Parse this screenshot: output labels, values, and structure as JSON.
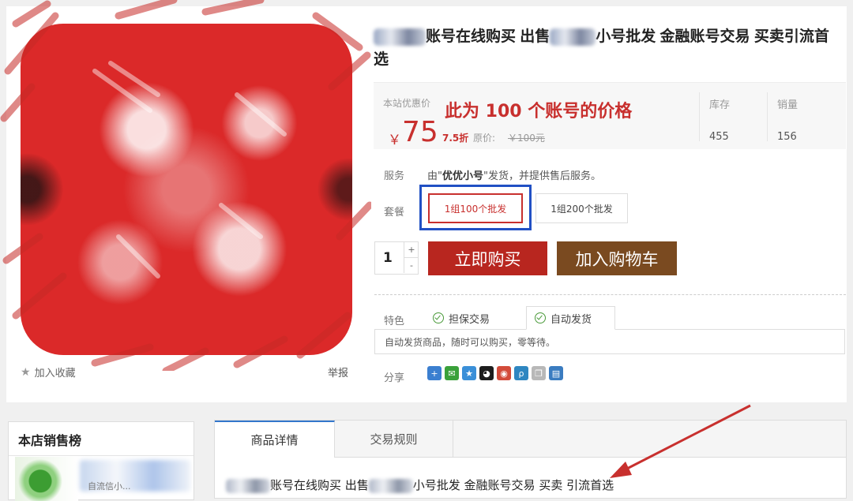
{
  "product": {
    "title_part1": "账号在线购买 出售",
    "title_part2": "小号批发 金融账号交易 买卖引流首选",
    "favorite_label": "加入收藏",
    "report_label": "举报"
  },
  "price": {
    "label": "本站优惠价",
    "annotation": "此为 100 个账号的价格",
    "currency": "￥",
    "value": "75",
    "discount": "7.5折",
    "original_label": "原价:",
    "original_value": "￥100元",
    "stock_label": "库存",
    "stock_value": "455",
    "sales_label": "销量",
    "sales_value": "156"
  },
  "service": {
    "label": "服务",
    "prefix": "由\"",
    "seller": "优优小号",
    "suffix": "\"发货，并提供售后服务。"
  },
  "package": {
    "label": "套餐",
    "options": [
      "1组100个批发",
      "1组200个批发"
    ],
    "selected_index": 0
  },
  "purchase": {
    "quantity": "1",
    "plus": "+",
    "minus": "-",
    "buy_label": "立即购买",
    "cart_label": "加入购物车"
  },
  "features": {
    "label": "特色",
    "tabs": [
      "担保交易",
      "自动发货"
    ],
    "active_tab": 1,
    "description": "自动发货商品，随时可以购买，零等待。"
  },
  "share": {
    "label": "分享",
    "icons": [
      {
        "name": "add-share-icon",
        "color": "#3b7fd0",
        "glyph": "+"
      },
      {
        "name": "wechat-icon",
        "color": "#3aa13a",
        "glyph": "✉"
      },
      {
        "name": "qzone-icon",
        "color": "#3a8fd8",
        "glyph": "★"
      },
      {
        "name": "qq-icon",
        "color": "#1d1d1d",
        "glyph": "◕"
      },
      {
        "name": "weibo-icon",
        "color": "#d34b3a",
        "glyph": "◉"
      },
      {
        "name": "tencent-weibo-icon",
        "color": "#2e86c1",
        "glyph": "ρ"
      },
      {
        "name": "copy-icon",
        "color": "#b8b8b8",
        "glyph": "❐"
      },
      {
        "name": "print-icon",
        "color": "#3a7cc0",
        "glyph": "▤"
      }
    ]
  },
  "sidebar": {
    "title": "本店销售榜",
    "item_text": "自流信小..."
  },
  "detail": {
    "tabs": [
      "商品详情",
      "交易规则"
    ],
    "title_part1": "账号在线购买 出售",
    "title_part2": "小号批发 金融账号交易 买卖 引流首选"
  },
  "colors": {
    "accent_red": "#c8302e",
    "buy_button": "#b8261f",
    "cart_button": "#7a4a20",
    "highlight_box": "#2150c4",
    "annotation_arrow": "#c8302e"
  }
}
